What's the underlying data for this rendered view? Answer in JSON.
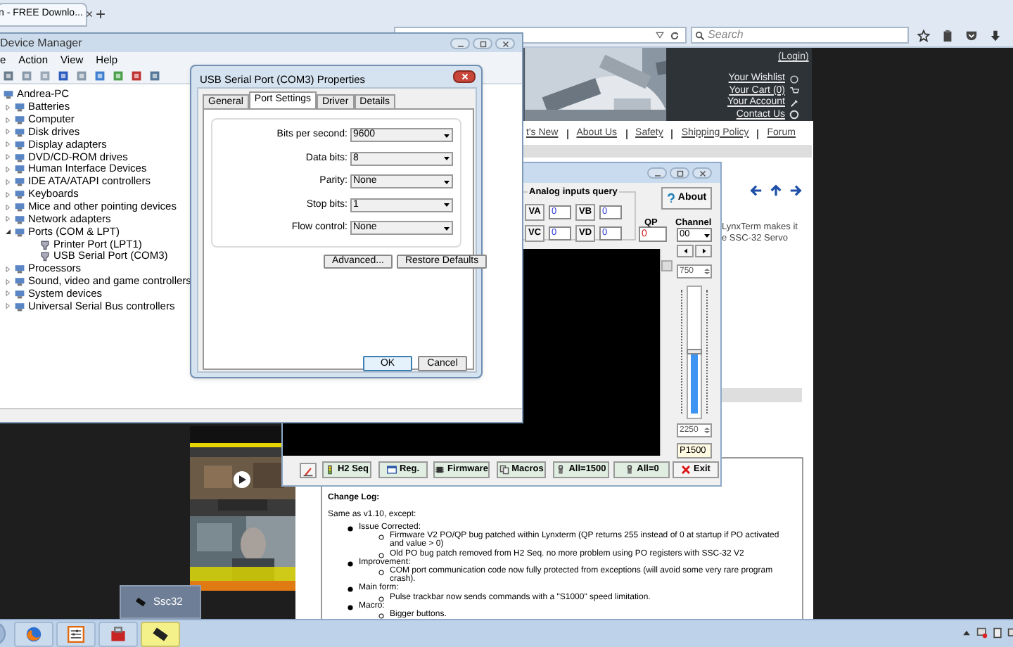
{
  "browser": {
    "tab": {
      "title": "n - FREE Downlo...",
      "close": "×"
    },
    "new_tab": "+",
    "search": {
      "placeholder": "Search"
    }
  },
  "web_page": {
    "header": {
      "kind": "picture"
    },
    "login": "(Login)",
    "account_links": [
      "Your Wishlist",
      "Your Cart (0)",
      "Your Account",
      "Contact Us"
    ],
    "nav": [
      "t's New",
      "About Us",
      "Safety",
      "Shipping Policy",
      "Forum"
    ],
    "intro_text": [
      "LynxTerm makes it",
      "e SSC-32 Servo"
    ],
    "ads": [
      {
        "kind": "picture"
      },
      {
        "kind": "picture"
      }
    ],
    "change_log": {
      "title": "Change Log:",
      "intro": "Same as v1.10, except:",
      "items": [
        {
          "text": "Issue Corrected:",
          "children": [
            {
              "text": "Firmware V2 PO/QP bug patched within Lynxterm (QP returns 255 instead of 0 at startup if PO activated and value > 0)"
            },
            {
              "text": "Old PO bug patch removed from H2 Seq. no more problem using PO registers with SSC-32 V2"
            }
          ]
        },
        {
          "text": "Improvement:",
          "children": [
            {
              "text": "COM port communication code now fully protected from exceptions (will avoid some very rare program crash)."
            }
          ]
        },
        {
          "text": "Main form:",
          "children": [
            {
              "text": "Pulse trackbar now sends commands with a \"S1000\" speed limitation."
            }
          ]
        },
        {
          "text": "Macro:",
          "children": [
            {
              "text": "Bigger buttons."
            }
          ]
        }
      ]
    }
  },
  "device_manager": {
    "title": "Device Manager",
    "menu": [
      "e",
      "Action",
      "View",
      "Help"
    ],
    "tree": {
      "text": "Andrea-PC",
      "children": [
        {
          "text": "Batteries",
          "expanded": false
        },
        {
          "text": "Computer",
          "expanded": false
        },
        {
          "text": "Disk drives",
          "expanded": false
        },
        {
          "text": "Display adapters",
          "expanded": false
        },
        {
          "text": "DVD/CD-ROM drives",
          "expanded": false
        },
        {
          "text": "Human Interface Devices",
          "expanded": false
        },
        {
          "text": "IDE ATA/ATAPI controllers",
          "expanded": false
        },
        {
          "text": "Keyboards",
          "expanded": false
        },
        {
          "text": "Mice and other pointing devices",
          "expanded": false
        },
        {
          "text": "Network adapters",
          "expanded": false
        },
        {
          "text": "Ports (COM & LPT)",
          "expanded": true,
          "children": [
            {
              "text": "Printer Port (LPT1)"
            },
            {
              "text": "USB Serial Port (COM3)"
            }
          ]
        },
        {
          "text": "Processors",
          "expanded": false
        },
        {
          "text": "Sound, video and game controllers",
          "expanded": false
        },
        {
          "text": "System devices",
          "expanded": false
        },
        {
          "text": "Universal Serial Bus controllers",
          "expanded": false
        }
      ]
    }
  },
  "properties_dialog": {
    "title": "USB Serial Port (COM3) Properties",
    "tabs": [
      {
        "label": "General",
        "selected": false
      },
      {
        "label": "Port Settings",
        "selected": true
      },
      {
        "label": "Driver",
        "selected": false
      },
      {
        "label": "Details",
        "selected": false
      }
    ],
    "fields": [
      {
        "label": "Bits per second:",
        "value": "9600"
      },
      {
        "label": "Data bits:",
        "value": "8"
      },
      {
        "label": "Parity:",
        "value": "None"
      },
      {
        "label": "Stop bits:",
        "value": "1"
      },
      {
        "label": "Flow control:",
        "value": "None"
      }
    ],
    "buttons": [
      "Advanced...",
      "Restore Defaults"
    ],
    "footer_buttons": [
      "OK",
      "Cancel"
    ]
  },
  "lynxterm": {
    "analog_title": "Analog inputs query",
    "analog": [
      {
        "label": "VA",
        "value": "0"
      },
      {
        "label": "VB",
        "value": "0"
      },
      {
        "label": "VC",
        "value": "0"
      },
      {
        "label": "VD",
        "value": "0"
      }
    ],
    "about": "About",
    "qp": {
      "label": "QP",
      "value": "0"
    },
    "channel": {
      "label": "Channel",
      "value": "00"
    },
    "min": "750",
    "max": "2250",
    "slider": {
      "level": 0.5
    },
    "pulse": "P1500",
    "buttons": [
      {
        "kind": "seq",
        "label": "H2 Seq"
      },
      {
        "kind": "reg",
        "label": "Reg."
      },
      {
        "kind": "firmware",
        "label": "Firmware"
      },
      {
        "kind": "macros",
        "label": "Macros"
      },
      {
        "kind": "servo",
        "label": "All=1500"
      },
      {
        "kind": "servo",
        "label": "All=0"
      },
      {
        "kind": "exit",
        "label": "Exit"
      }
    ]
  },
  "taskbar": {
    "apps": [
      {
        "kind": "browser",
        "selected": false
      },
      {
        "kind": "settings",
        "selected": false
      },
      {
        "kind": "toolbox",
        "selected": false
      },
      {
        "kind": "chip",
        "selected": true
      }
    ],
    "tooltip": "Ssc32"
  }
}
